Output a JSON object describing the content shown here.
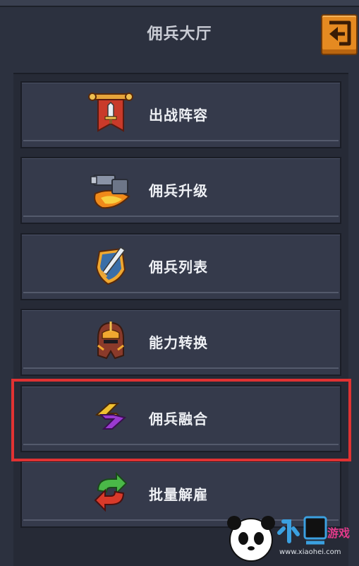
{
  "header": {
    "title": "佣兵大厅"
  },
  "menu": [
    {
      "label": "出战阵容",
      "icon": "banner-sword-icon"
    },
    {
      "label": "佣兵升级",
      "icon": "anvil-icon"
    },
    {
      "label": "佣兵列表",
      "icon": "shield-sword-icon"
    },
    {
      "label": "能力转换",
      "icon": "helmet-icon"
    },
    {
      "label": "佣兵融合",
      "icon": "fusion-icon"
    },
    {
      "label": "批量解雇",
      "icon": "recycle-arrows-icon"
    }
  ],
  "watermark": {
    "brand": "小黑游戏",
    "url": "www.xiaohei.com"
  },
  "colors": {
    "accent": "#e58a21",
    "highlight": "#e03232",
    "row_bg": "#353a4b"
  }
}
